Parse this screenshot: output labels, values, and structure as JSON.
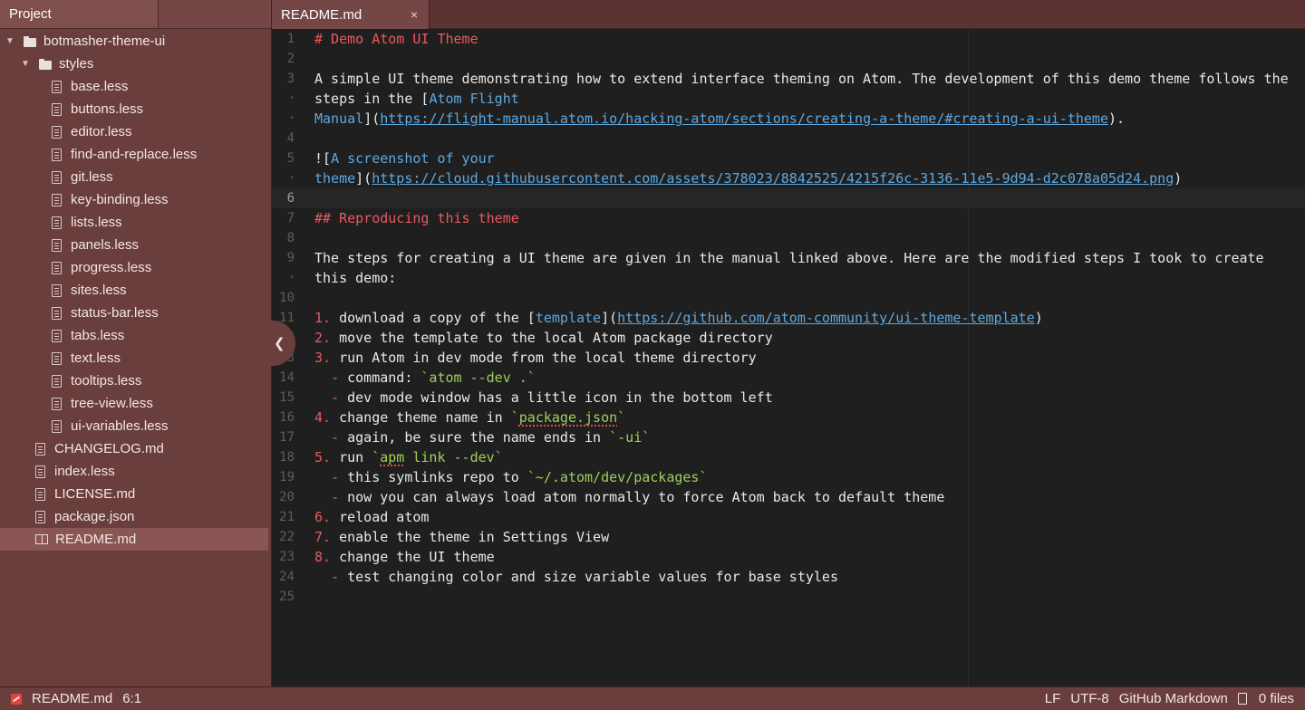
{
  "sidebar": {
    "title": "Project",
    "root": "botmasher-theme-ui",
    "styles_folder": "styles",
    "style_files": [
      "base.less",
      "buttons.less",
      "editor.less",
      "find-and-replace.less",
      "git.less",
      "key-binding.less",
      "lists.less",
      "panels.less",
      "progress.less",
      "sites.less",
      "status-bar.less",
      "tabs.less",
      "text.less",
      "tooltips.less",
      "tree-view.less",
      "ui-variables.less"
    ],
    "root_files": [
      "CHANGELOG.md",
      "index.less",
      "LICENSE.md",
      "package.json",
      "README.md"
    ],
    "selected_file": "README.md"
  },
  "tab": {
    "title": "README.md",
    "close": "×"
  },
  "editor": {
    "cursor_line": 6,
    "lines": [
      {
        "n": "1",
        "t": "# Demo Atom UI Theme"
      },
      {
        "n": "2",
        "t": ""
      },
      {
        "n": "3",
        "t": "A simple UI theme demonstrating how to extend interface theming on Atom. The development of this demo theme follows the"
      },
      {
        "n": "•",
        "t": "steps in the [Atom Flight"
      },
      {
        "n": "•",
        "t": "Manual](https://flight-manual.atom.io/hacking-atom/sections/creating-a-theme/#creating-a-ui-theme)."
      },
      {
        "n": "4",
        "t": ""
      },
      {
        "n": "5",
        "t": "![A screenshot of your"
      },
      {
        "n": "•",
        "t": "theme](https://cloud.githubusercontent.com/assets/378023/8842525/4215f26c-3136-11e5-9d94-d2c078a05d24.png)"
      },
      {
        "n": "6",
        "t": ""
      },
      {
        "n": "7",
        "t": "## Reproducing this theme"
      },
      {
        "n": "8",
        "t": ""
      },
      {
        "n": "9",
        "t": "The steps for creating a UI theme are given in the manual linked above. Here are the modified steps I took to create"
      },
      {
        "n": "•",
        "t": "this demo:"
      },
      {
        "n": "10",
        "t": ""
      },
      {
        "n": "11",
        "t": "1. download a copy of the [template](https://github.com/atom-community/ui-theme-template)"
      },
      {
        "n": "12",
        "t": "2. move the template to the local Atom package directory"
      },
      {
        "n": "13",
        "t": "3. run Atom in dev mode from the local theme directory"
      },
      {
        "n": "14",
        "t": "  - command: `atom --dev .`"
      },
      {
        "n": "15",
        "t": "  - dev mode window has a little icon in the bottom left"
      },
      {
        "n": "16",
        "t": "4. change theme name in `package.json`"
      },
      {
        "n": "17",
        "t": "  - again, be sure the name ends in `-ui`"
      },
      {
        "n": "18",
        "t": "5. run `apm link --dev`"
      },
      {
        "n": "19",
        "t": "  - this symlinks repo to `~/.atom/dev/packages`"
      },
      {
        "n": "20",
        "t": "  - now you can always load atom normally to force Atom back to default theme"
      },
      {
        "n": "21",
        "t": "6. reload atom"
      },
      {
        "n": "22",
        "t": "7. enable the theme in Settings View"
      },
      {
        "n": "23",
        "t": "8. change the UI theme"
      },
      {
        "n": "24",
        "t": "  - test changing color and size variable values for base styles"
      },
      {
        "n": "25",
        "t": ""
      }
    ]
  },
  "status_bar": {
    "file": "README.md",
    "position": "6:1",
    "line_ending": "LF",
    "encoding": "UTF-8",
    "grammar": "GitHub Markdown",
    "files": "0 files"
  },
  "colors": {
    "sidebar_bg": "#6a3e3c",
    "editor_bg": "#1f1f1f",
    "heading": "#e85a5f",
    "link": "#5fa8e0",
    "code": "#9fd05a"
  }
}
